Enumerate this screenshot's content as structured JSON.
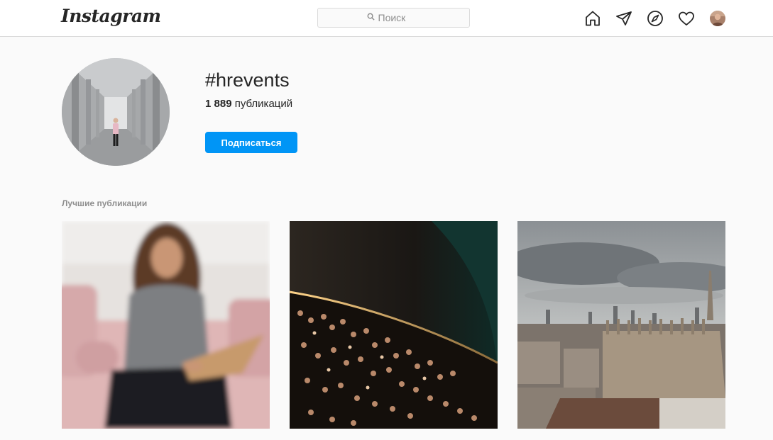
{
  "nav": {
    "logo_text": "Instagram",
    "search_placeholder": "Поиск",
    "icons": [
      "home-icon",
      "direct-icon",
      "explore-icon",
      "activity-heart-icon",
      "profile-avatar"
    ]
  },
  "hashtag": {
    "name": "#hrevents",
    "post_count": "1 889",
    "post_count_label": "публикаций",
    "follow_label": "Подписаться"
  },
  "top_posts": {
    "title": "Лучшие публикации",
    "posts": [
      {
        "subject": "woman with laptop on pink sofa"
      },
      {
        "subject": "concert crowd under dome"
      },
      {
        "subject": "city skyline with cathedral"
      }
    ]
  },
  "colors": {
    "accent": "#0095f6",
    "border": "#dbdbdb",
    "background": "#fafafa"
  }
}
